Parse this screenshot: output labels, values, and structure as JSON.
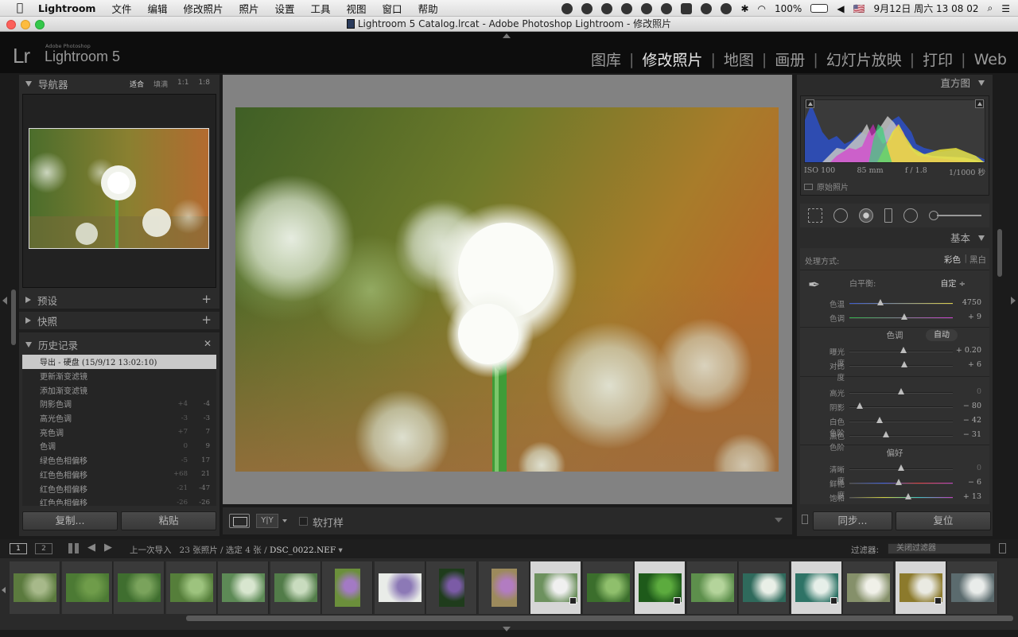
{
  "menubar": {
    "apple": "",
    "app": "Lightroom",
    "items": [
      "文件",
      "编辑",
      "修改照片",
      "照片",
      "设置",
      "工具",
      "视图",
      "窗口",
      "帮助"
    ],
    "battery": "100%",
    "flag": "🇺🇸",
    "datetime": "9月12日 周六  13 08 02"
  },
  "window": {
    "title": "Lightroom 5 Catalog.lrcat - Adobe Photoshop Lightroom - 修改照片"
  },
  "identity": {
    "logo": "Lr",
    "brand_small": "Adobe Photoshop",
    "product": "Lightroom 5"
  },
  "modules": [
    "图库",
    "修改照片",
    "地图",
    "画册",
    "幻灯片放映",
    "打印",
    "Web"
  ],
  "active_module": "修改照片",
  "left": {
    "navigator": {
      "title": "导航器",
      "zoom": [
        "适合",
        "填满",
        "1:1",
        "1:8"
      ],
      "zoom_selected": "适合"
    },
    "presets": "预设",
    "snapshots": "快照",
    "history": {
      "title": "历史记录",
      "rows": [
        {
          "label": "导出 - 硬盘 (15/9/12 13:02:10)",
          "a": "",
          "b": ""
        },
        {
          "label": "更新渐变滤镜",
          "a": "",
          "b": ""
        },
        {
          "label": "添加渐变滤镜",
          "a": "",
          "b": ""
        },
        {
          "label": "阴影色调",
          "a": "+4",
          "b": "-4"
        },
        {
          "label": "高光色调",
          "a": "-3",
          "b": "-3"
        },
        {
          "label": "亮色调",
          "a": "+7",
          "b": "7"
        },
        {
          "label": "色调",
          "a": "0",
          "b": "9"
        },
        {
          "label": "绿色色相偏移",
          "a": "-5",
          "b": "17"
        },
        {
          "label": "红色色相偏移",
          "a": "+68",
          "b": "21"
        },
        {
          "label": "红色色相偏移",
          "a": "-21",
          "b": "-47"
        },
        {
          "label": "红色色相偏移",
          "a": "-26",
          "b": "-26"
        }
      ]
    },
    "copy_button": "复制...",
    "paste_button": "粘贴"
  },
  "toolbar": {
    "yy": "Y|Y",
    "softproof": "软打样"
  },
  "right": {
    "histogram": {
      "title": "直方图",
      "iso": "ISO 100",
      "focal": "85 mm",
      "aperture": "f / 1.8",
      "shutter": "1/1000 秒",
      "original": "原始照片"
    },
    "basic": {
      "title": "基本",
      "treatment_label": "处理方式:",
      "treatment_color": "彩色",
      "treatment_bw": "黑白",
      "wb_label": "白平衡:",
      "wb_value": "自定 ÷",
      "temp": {
        "label": "色温",
        "value": "4750",
        "pos": 0.3
      },
      "tint": {
        "label": "色调",
        "value": "+ 9",
        "pos": 0.53
      },
      "tone_title": "色调",
      "auto": "自动",
      "exposure": {
        "label": "曝光度",
        "value": "+ 0.20",
        "pos": 0.52
      },
      "contrast": {
        "label": "对比度",
        "value": "+ 6",
        "pos": 0.53
      },
      "highlights": {
        "label": "高光",
        "value": "0",
        "pos": 0.5
      },
      "shadows": {
        "label": "阴影",
        "value": "− 80",
        "pos": 0.1
      },
      "whites": {
        "label": "白色色阶",
        "value": "− 42",
        "pos": 0.29
      },
      "blacks": {
        "label": "黑色色阶",
        "value": "− 31",
        "pos": 0.35
      },
      "presence_title": "偏好",
      "clarity": {
        "label": "清晰度",
        "value": "0",
        "pos": 0.5
      },
      "vibrance": {
        "label": "鲜艳度",
        "value": "− 6",
        "pos": 0.48
      },
      "saturation": {
        "label": "饱和度",
        "value": "+ 13",
        "pos": 0.57
      }
    },
    "sync_button": "同步...",
    "reset_button": "复位"
  },
  "filmstrip": {
    "page1": "1",
    "page2": "2",
    "source": "上一次导入",
    "count": "23 张照片 / 选定 4 张 /",
    "filename": "DSC_0022.NEF",
    "filter_label": "过滤器:",
    "filter_value": "关闭过滤器",
    "thumbs": [
      {
        "c1": "#5b7a3e",
        "c2": "#a7b98a",
        "sel": false,
        "port": false,
        "badge": false
      },
      {
        "c1": "#4c7a34",
        "c2": "#6f9c4a",
        "sel": false,
        "port": false,
        "badge": false
      },
      {
        "c1": "#3f6e2f",
        "c2": "#7aa35c",
        "sel": false,
        "port": false,
        "badge": false
      },
      {
        "c1": "#557e3a",
        "c2": "#9dc37e",
        "sel": false,
        "port": false,
        "badge": false
      },
      {
        "c1": "#5d8a56",
        "c2": "#d8e6cf",
        "sel": false,
        "port": false,
        "badge": false
      },
      {
        "c1": "#527c49",
        "c2": "#c9dcbf",
        "sel": false,
        "port": false,
        "badge": false
      },
      {
        "c1": "#6b8f3b",
        "c2": "#a37ac4",
        "sel": false,
        "port": true,
        "badge": false
      },
      {
        "c1": "#e9ece8",
        "c2": "#8c79b6",
        "sel": false,
        "port": false,
        "badge": false
      },
      {
        "c1": "#1f3c1c",
        "c2": "#7b5ba6",
        "sel": false,
        "port": true,
        "badge": false
      },
      {
        "c1": "#9c8a5c",
        "c2": "#b27cc1",
        "sel": false,
        "port": true,
        "badge": false
      },
      {
        "c1": "#6d915e",
        "c2": "#f0f0f0",
        "sel": true,
        "port": false,
        "badge": true
      },
      {
        "c1": "#3b6e2c",
        "c2": "#8fbf6c",
        "sel": false,
        "port": false,
        "badge": false
      },
      {
        "c1": "#1e5a1a",
        "c2": "#5cab3e",
        "sel": true,
        "port": false,
        "badge": true
      },
      {
        "c1": "#5d8f4c",
        "c2": "#b4d49b",
        "sel": false,
        "port": false,
        "badge": false
      },
      {
        "c1": "#2f6a5c",
        "c2": "#e9efe7",
        "sel": false,
        "port": false,
        "badge": false
      },
      {
        "c1": "#2e7366",
        "c2": "#e6efe9",
        "sel": true,
        "port": false,
        "badge": true
      },
      {
        "c1": "#85906a",
        "c2": "#f0f0e8",
        "sel": false,
        "port": false,
        "badge": false
      },
      {
        "c1": "#8c7a2c",
        "c2": "#eaeae2",
        "sel": true,
        "port": false,
        "badge": true
      },
      {
        "c1": "#5b6b6e",
        "c2": "#e9ecea",
        "sel": false,
        "port": false,
        "badge": false
      }
    ]
  },
  "colors": {
    "panel": "#2b2b2b",
    "canvas": "#828282",
    "accent_active": "#e8e8e8"
  }
}
